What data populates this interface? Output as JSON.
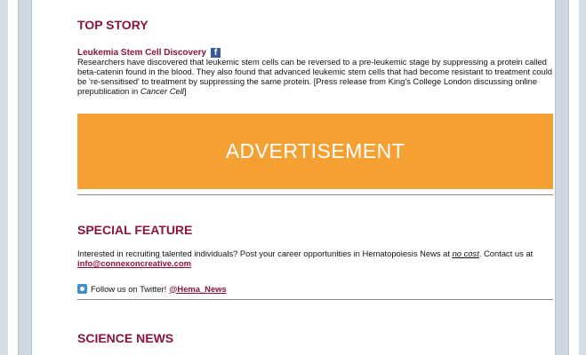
{
  "top_story": {
    "heading": "TOP STORY",
    "title": "Leukemia Stem Cell Discovery",
    "facebook_icon": "facebook-icon",
    "body_main": "Researchers have discovered that leukemic stem cells can be reversed to a pre-leukemic stage by suppressing a protein called beta-catenin found in the blood. They also found that advanced leukemic stem cells that had become resistant to treatment could be 're-sensitised' to treatment by suppressing the same protein. [Press release from King's College London discussing online prepublication in ",
    "body_journal": "Cancer Cell",
    "body_end": "]"
  },
  "advertisement": {
    "label": "ADVERTISEMENT",
    "color": "#f5a032"
  },
  "special_feature": {
    "heading": "SPECIAL FEATURE",
    "body_start": "Interested in recruiting talented individuals? Post your career opportunities in Hematopoiesis News at ",
    "no_cost": "no cost",
    "body_mid": ". Contact us at ",
    "email": "info@connexoncreative.com",
    "twitter_icon": "twitter-icon",
    "twitter_text": "Follow us on Twitter! ",
    "twitter_handle": "@Hema_News"
  },
  "science_news": {
    "heading": "SCIENCE NEWS"
  },
  "colors": {
    "heading": "#8b1538",
    "background": "#d6dce4"
  }
}
